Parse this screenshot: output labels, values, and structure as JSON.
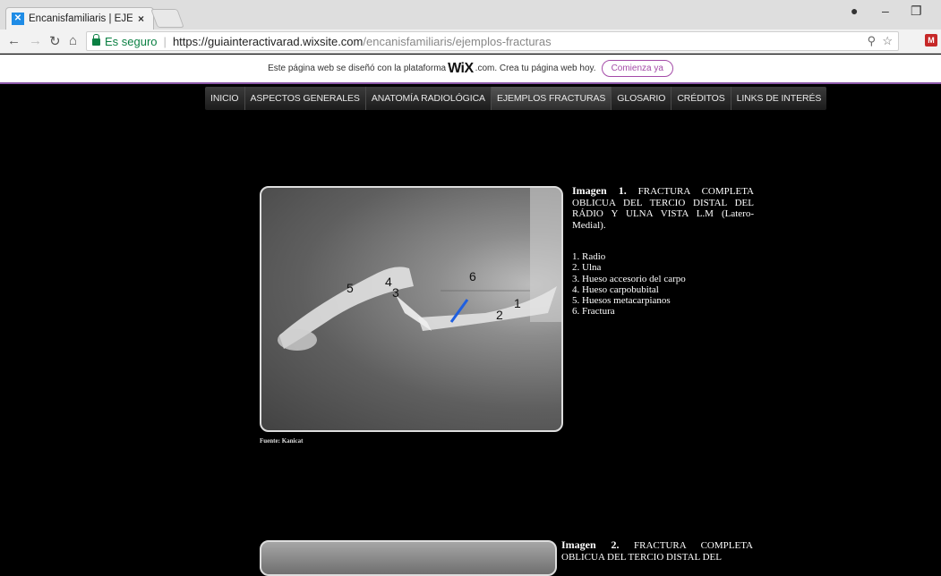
{
  "browser": {
    "tab_title": "Encanisfamiliaris | EJEMPL",
    "tab_close": "×",
    "secure_label": "Es seguro",
    "url_host": "https://guiainteractivarad.wixsite.com",
    "url_path": "/encanisfamiliaris/ejemplos-fracturas"
  },
  "wix_banner": {
    "text_before": "Este página web se diseñó con la plataforma",
    "logo": "WiX",
    "text_after": ".com. Crea tu página web hoy.",
    "button": "Comienza ya"
  },
  "nav": {
    "items": [
      "INICIO",
      "ASPECTOS GENERALES",
      "ANATOMÍA RADIOLÓGICA",
      "EJEMPLOS FRACTURAS",
      "GLOSARIO",
      "CRÉDITOS",
      "LINKS DE INTERÉS"
    ]
  },
  "image1": {
    "labels": [
      "1",
      "2",
      "3",
      "4",
      "5",
      "6"
    ],
    "source": "Fuente: Kanicat",
    "title_bold": "Imagen 1.",
    "title_text": " FRACTURA COMPLETA OBLICUA DEL TERCIO DISTAL DEL RÁDIO Y ULNA VISTA L.M (Latero-Medial).",
    "legend": [
      "1. Radio",
      "2. Ulna",
      "3. Hueso accesorio del carpo",
      "4. Hueso carpobubital",
      "5. Huesos metacarpianos",
      "6. Fractura"
    ]
  },
  "image2": {
    "title_bold": "Imagen 2.",
    "title_text": " FRACTURA COMPLETA OBLICUA DEL TERCIO DISTAL DEL"
  },
  "colors": {
    "secure": "#0b8043",
    "wix_accent": "#a44ba8",
    "background": "#000000"
  }
}
